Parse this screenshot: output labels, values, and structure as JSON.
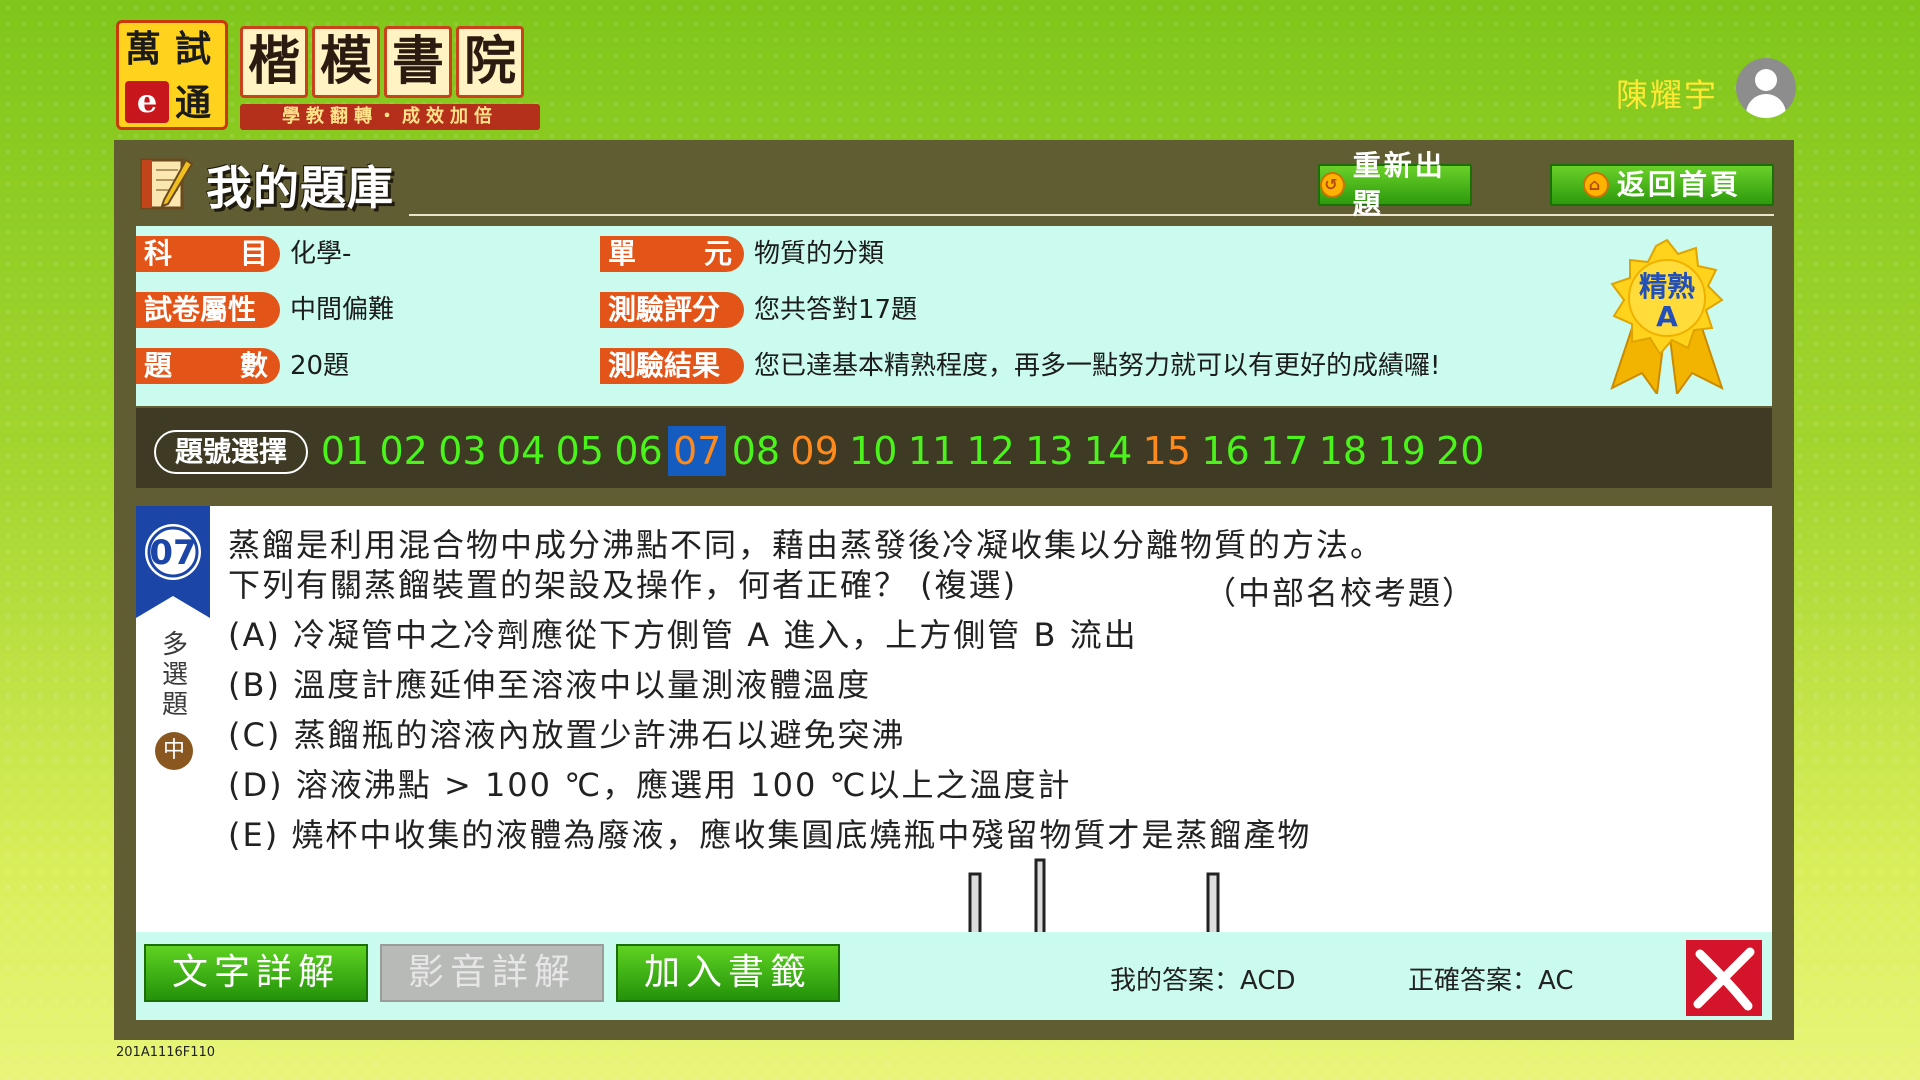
{
  "logo": {
    "box_chars": [
      "萬",
      "試",
      "e",
      "通"
    ],
    "title_chars": [
      "楷",
      "模",
      "書",
      "院"
    ],
    "subtitle": "學教翻轉・成效加倍"
  },
  "user": {
    "name": "陳耀宇",
    "avatar_icon": "user-icon"
  },
  "header": {
    "title": "我的題庫",
    "icon": "notebook-pencil-icon",
    "redo_label": "重新出題",
    "home_label": "返回首頁"
  },
  "info": {
    "subject_label_chars": [
      "科",
      "目"
    ],
    "subject_value": "化學-",
    "unit_label_chars": [
      "單",
      "元"
    ],
    "unit_value": "物質的分類",
    "attr_label": "試卷屬性",
    "attr_value": "中間偏難",
    "score_label": "測驗評分",
    "score_value": "您共答對17題",
    "count_label_chars": [
      "題",
      "數"
    ],
    "count_value": "20題",
    "result_label": "測驗結果",
    "result_value": "您已達基本精熟程度，再多一點努力就可以有更好的成績囉!",
    "badge_line1": "精熟",
    "badge_line2": "A"
  },
  "question_nav": {
    "select_label": "題號選擇",
    "numbers": [
      "01",
      "02",
      "03",
      "04",
      "05",
      "06",
      "07",
      "08",
      "09",
      "10",
      "11",
      "12",
      "13",
      "14",
      "15",
      "16",
      "17",
      "18",
      "19",
      "20"
    ],
    "current": "07",
    "wrong": [
      "07",
      "09",
      "15"
    ],
    "colors": {
      "correct": "#4af41a",
      "wrong": "#ff8a1c",
      "current_bg": "#155cc0"
    }
  },
  "question": {
    "number": "07",
    "type_chars": [
      "多",
      "選",
      "題"
    ],
    "difficulty": "中",
    "stem_line1": "蒸餾是利用混合物中成分沸點不同，藉由蒸發後冷凝收集以分離物質的方法。",
    "stem_line2": "下列有關蒸餾裝置的架設及操作，何者正確？ (複選)",
    "source": "（中部名校考題）",
    "options": [
      "(A) 冷凝管中之冷劑應從下方側管 A 進入，上方側管 B 流出",
      "(B) 溫度計應延伸至溶液中以量測液體溫度",
      "(C) 蒸餾瓶的溶液內放置少許沸石以避免突沸",
      "(D) 溶液沸點 > 100 ℃，應選用 100 ℃以上之溫度計",
      "(E) 燒杯中收集的液體為廢液，應收集圓底燒瓶中殘留物質才是蒸餾產物"
    ]
  },
  "bottom": {
    "text_explain": "文字詳解",
    "video_explain": "影音詳解",
    "bookmark": "加入書籤",
    "my_answer_label": "我的答案：",
    "my_answer": "ACD",
    "correct_answer_label": "正確答案：",
    "correct_answer": "AC",
    "result_icon": "wrong-x-icon"
  },
  "footer_code": "201A1116F110"
}
